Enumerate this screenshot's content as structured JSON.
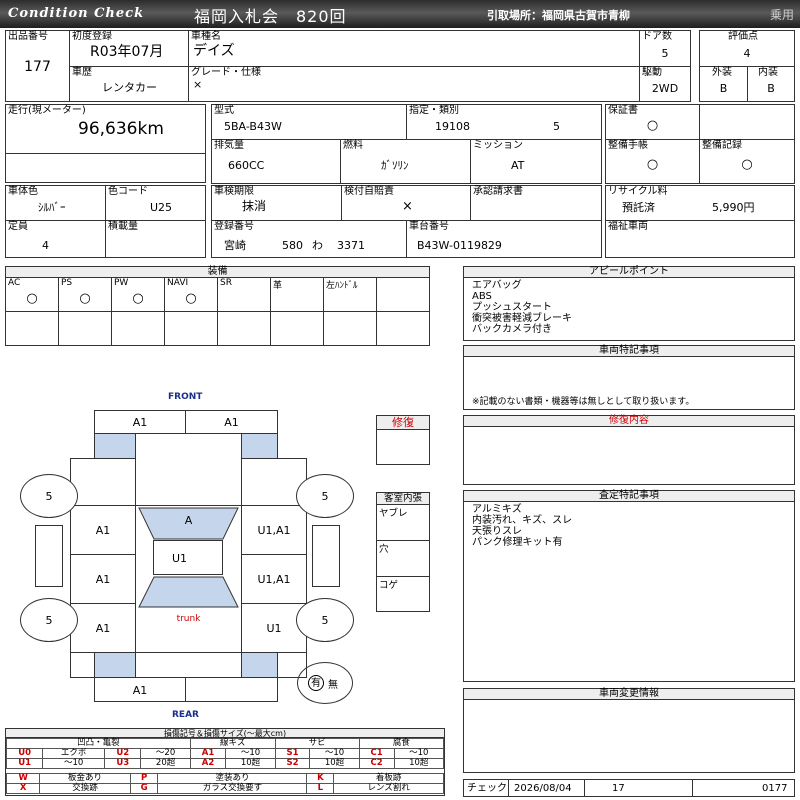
{
  "header": {
    "logo": "Condition  Check",
    "title": "福岡入札会　820回",
    "location": "引取場所：福岡県古賀市青柳",
    "category": "乗用"
  },
  "lot": {
    "label": "出品番号",
    "value": "177"
  },
  "first_reg": {
    "label": "初度登録",
    "value": "R03年07月"
  },
  "car_name": {
    "label": "車種名",
    "value": "デイズ"
  },
  "doors": {
    "label": "ドア数",
    "value": "5"
  },
  "rating": {
    "label": "評価点",
    "value": "4"
  },
  "history": {
    "label": "車歴",
    "value": "レンタカー"
  },
  "grade": {
    "label": "グレード・仕様",
    "value": "×"
  },
  "drive": {
    "label": "駆動",
    "value": "2WD"
  },
  "exterior": {
    "label": "外装",
    "value": "B"
  },
  "interior": {
    "label": "内装",
    "value": "B"
  },
  "mileage": {
    "label": "走行(現メーター)",
    "value": "96,636km"
  },
  "model": {
    "label": "型式",
    "value": "5BA-B43W"
  },
  "designation": {
    "label": "指定・類別",
    "value1": "19108",
    "value2": "5"
  },
  "warranty": {
    "label": "保証書",
    "value": "○"
  },
  "displacement": {
    "label": "排気量",
    "value": "660CC"
  },
  "fuel": {
    "label": "燃料",
    "value": "ｶﾞｿﾘﾝ"
  },
  "transmission": {
    "label": "ミッション",
    "value": "AT"
  },
  "maint_book": {
    "label": "整備手帳",
    "value": "○"
  },
  "maint_record": {
    "label": "整備記録",
    "value": "○"
  },
  "body_color": {
    "label": "車体色",
    "value": "ｼﾙﾊﾞｰ"
  },
  "color_code": {
    "label": "色コード",
    "value": "U25"
  },
  "inspection": {
    "label": "車検期限",
    "value": "抹消"
  },
  "insurance": {
    "label": "検付自賠責",
    "value": "×"
  },
  "approval": {
    "label": "承認請求書",
    "value": ""
  },
  "recycle": {
    "label": "リサイクル料",
    "status": "預託済",
    "amount": "5,990円"
  },
  "capacity": {
    "label": "定員",
    "value": "4"
  },
  "load": {
    "label": "積載量",
    "value": ""
  },
  "reg_no": {
    "label": "登録番号",
    "place": "宮崎",
    "class": "580",
    "kana": "わ",
    "num": "3371"
  },
  "chassis": {
    "label": "車台番号",
    "value": "B43W-0119829"
  },
  "welfare": {
    "label": "福祉車両",
    "value": ""
  },
  "equipment": {
    "title": "装備",
    "items": [
      {
        "label": "AC",
        "value": "○"
      },
      {
        "label": "PS",
        "value": "○"
      },
      {
        "label": "PW",
        "value": "○"
      },
      {
        "label": "NAVI",
        "value": "○"
      },
      {
        "label": "SR",
        "value": ""
      },
      {
        "label": "革",
        "value": ""
      },
      {
        "label": "左ﾊﾝﾄﾞﾙ",
        "value": ""
      }
    ]
  },
  "appeal": {
    "title": "アピールポイント",
    "text": "エアバッグ\nABS\nプッシュスタート\n衝突被害軽減ブレーキ\nバックカメラ付き"
  },
  "special": {
    "title": "車両特記事項",
    "note": "※記載のない書類・機器等は無しとして取り扱います。"
  },
  "repair": {
    "title": "修復内容",
    "text": ""
  },
  "assessment": {
    "title": "査定特記事項",
    "text": "アルミキズ\n内装汚れ、キズ、スレ\n天張りスレ\nパンク修理キット有"
  },
  "change": {
    "title": "車両変更情報",
    "text": ""
  },
  "diagram": {
    "front": "FRONT",
    "rear": "REAR",
    "repair_label": "修復",
    "trunk": "trunk",
    "tires": [
      "5",
      "5",
      "5",
      "5"
    ],
    "parts": {
      "front_l": "A1",
      "front_r": "A1",
      "hood": "A",
      "lf_fender": "A1",
      "rf_fender": "U1,A1",
      "roof": "U1",
      "ld": "A1",
      "rd": "U1,A1",
      "lr_fender": "A1",
      "rr_fender": "U1",
      "rear": "A1"
    },
    "cabin_title": "客室内張",
    "cabin": [
      "ヤブレ",
      "穴",
      "コゲ"
    ],
    "spare": "有",
    "spare_none": "無"
  },
  "legend": {
    "title": "損傷記号＆損傷サイズ(～最大cm)",
    "groups": [
      {
        "name": "凹凸・亀裂"
      },
      {
        "name": "線キズ"
      },
      {
        "name": "サビ"
      },
      {
        "name": "腐食"
      }
    ],
    "row1": [
      "U0",
      "エクボ",
      "U2",
      "～20",
      "A1",
      "～10",
      "S1",
      "～10",
      "C1",
      "～10"
    ],
    "row2": [
      "U1",
      "～10",
      "U3",
      "20超",
      "A2",
      "10超",
      "S2",
      "10超",
      "C2",
      "10超"
    ],
    "row3": [
      "W",
      "板金あり",
      "P",
      "塗装あり",
      "K",
      "着板跡"
    ],
    "row4": [
      "X",
      "交換跡",
      "G",
      "ガラス交換要す",
      "L",
      "レンズ割れ"
    ]
  },
  "check": {
    "label": "チェック",
    "date": "2026/08/04",
    "num": "17",
    "code": "0177"
  }
}
